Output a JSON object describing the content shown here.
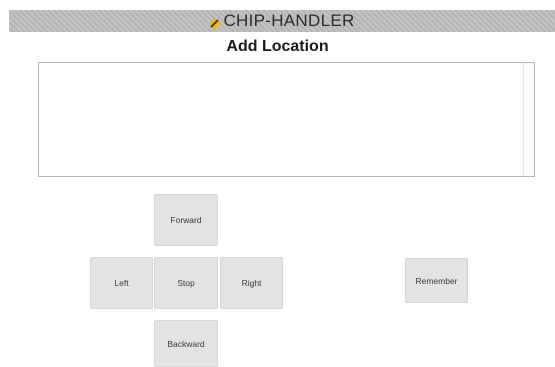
{
  "header": {
    "app_title": "CHIP-HANDLER",
    "logo_icon": "diamond-logo-icon",
    "colors": {
      "logo_yellow": "#f5b800",
      "logo_dark": "#2b2b2b",
      "bar": "#bcbcbc"
    }
  },
  "main": {
    "page_title": "Add Location",
    "location_text": ""
  },
  "controls": {
    "forward_label": "Forward",
    "left_label": "Left",
    "stop_label": "Stop",
    "right_label": "Right",
    "backward_label": "Backward",
    "remember_label": "Remember"
  }
}
